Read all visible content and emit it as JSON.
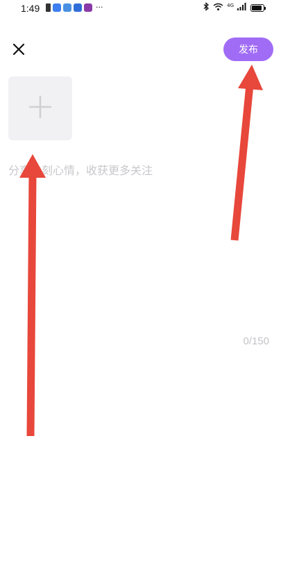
{
  "status_bar": {
    "time": "1:49",
    "more": "···",
    "network": "4G"
  },
  "header": {
    "close_icon": "close-icon",
    "publish_label": "发布"
  },
  "composer": {
    "add_media_icon": "plus-icon",
    "placeholder": "分享此刻心情，收获更多关注",
    "char_count": "0/150",
    "accent_color": "#a06cf5"
  },
  "annotations": {
    "arrow_color": "#e8473b"
  }
}
